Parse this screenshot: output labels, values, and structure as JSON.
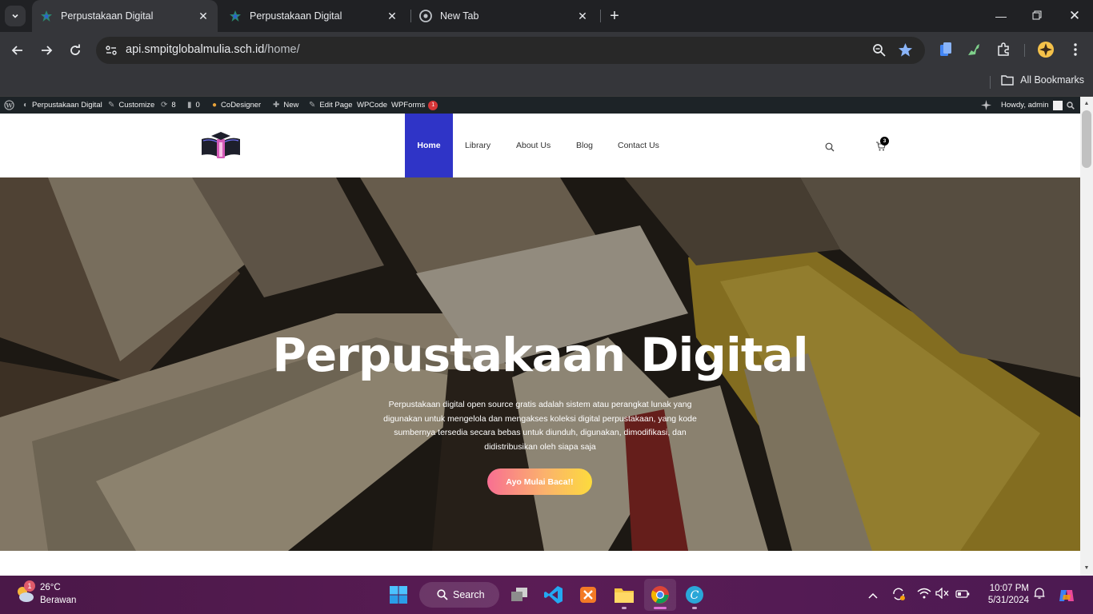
{
  "browser": {
    "tabs": [
      {
        "title": "Perpustakaan Digital",
        "active": true
      },
      {
        "title": "Perpustakaan Digital",
        "active": false
      },
      {
        "title": "New Tab",
        "active": false
      }
    ],
    "url_host": "api.smpitglobalmulia.sch.id",
    "url_path": "/home/",
    "bookmarks_label": "All Bookmarks"
  },
  "wp_admin_bar": {
    "site_name": "Perpustakaan Digital",
    "customize": "Customize",
    "updates_count": "8",
    "comments_count": "0",
    "codesigner": "CoDesigner",
    "new": "New",
    "edit_page": "Edit Page",
    "wpcode": "WPCode",
    "wpforms": "WPForms",
    "wpforms_badge": "1",
    "howdy": "Howdy, admin"
  },
  "site": {
    "nav": [
      {
        "label": "Home",
        "active": true
      },
      {
        "label": "Library"
      },
      {
        "label": "About Us"
      },
      {
        "label": "Blog"
      },
      {
        "label": "Contact Us"
      }
    ],
    "cart_count": "3",
    "accent_color": "#2f34c7"
  },
  "hero": {
    "title": "Perpustakaan Digital",
    "description": "Perpustakaan digital open source gratis adalah sistem atau perangkat lunak yang digunakan untuk mengelola dan mengakses koleksi digital perpustakaan, yang kode sumbernya tersedia secara bebas untuk diunduh, digunakan, dimodifikasi, dan didistribusikan oleh siapa saja",
    "button": "Ayo Mulai Baca!!"
  },
  "taskbar": {
    "weather_temp": "26°C",
    "weather_desc": "Berawan",
    "weather_badge": "1",
    "search_label": "Search",
    "time": "10:07 PM",
    "date": "5/31/2024"
  }
}
